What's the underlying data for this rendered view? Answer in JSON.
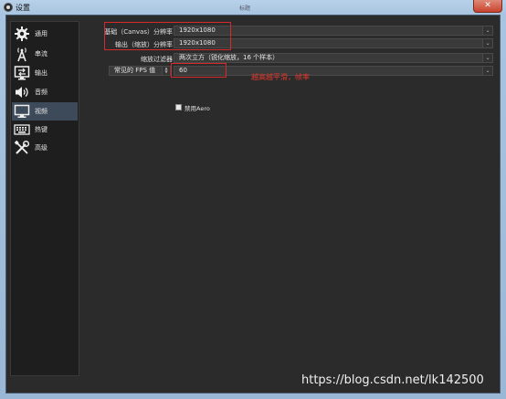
{
  "window": {
    "title": "设置",
    "center_title": "标题",
    "close_symbol": "✕"
  },
  "sidebar": {
    "items": [
      {
        "label": "通用",
        "icon": "gear-icon"
      },
      {
        "label": "串流",
        "icon": "antenna-icon"
      },
      {
        "label": "输出",
        "icon": "output-icon"
      },
      {
        "label": "音频",
        "icon": "speaker-icon"
      },
      {
        "label": "视频",
        "icon": "monitor-icon",
        "selected": true
      },
      {
        "label": "热键",
        "icon": "keyboard-icon"
      },
      {
        "label": "高级",
        "icon": "tools-icon"
      }
    ]
  },
  "video": {
    "base_resolution": {
      "label": "基础（Canvas）分辨率",
      "value": "1920x1080"
    },
    "output_resolution": {
      "label": "输出（缩放）分辨率",
      "value": "1920x1080"
    },
    "downscale_filter": {
      "label": "缩放过滤器",
      "value": "两次立方（锐化缩放，16 个样本）"
    },
    "fps": {
      "label": "常见的 FPS 值",
      "value": "60"
    },
    "disable_aero": {
      "label": "禁用Aero",
      "checked": false
    }
  },
  "annotation": "越高越平滑，帧率",
  "watermark": "https://blog.csdn.net/lk142500",
  "colors": {
    "highlight_box": "#d42a2a",
    "annotation_text": "#e03a2e",
    "selected_item": "#3d4a5a"
  }
}
